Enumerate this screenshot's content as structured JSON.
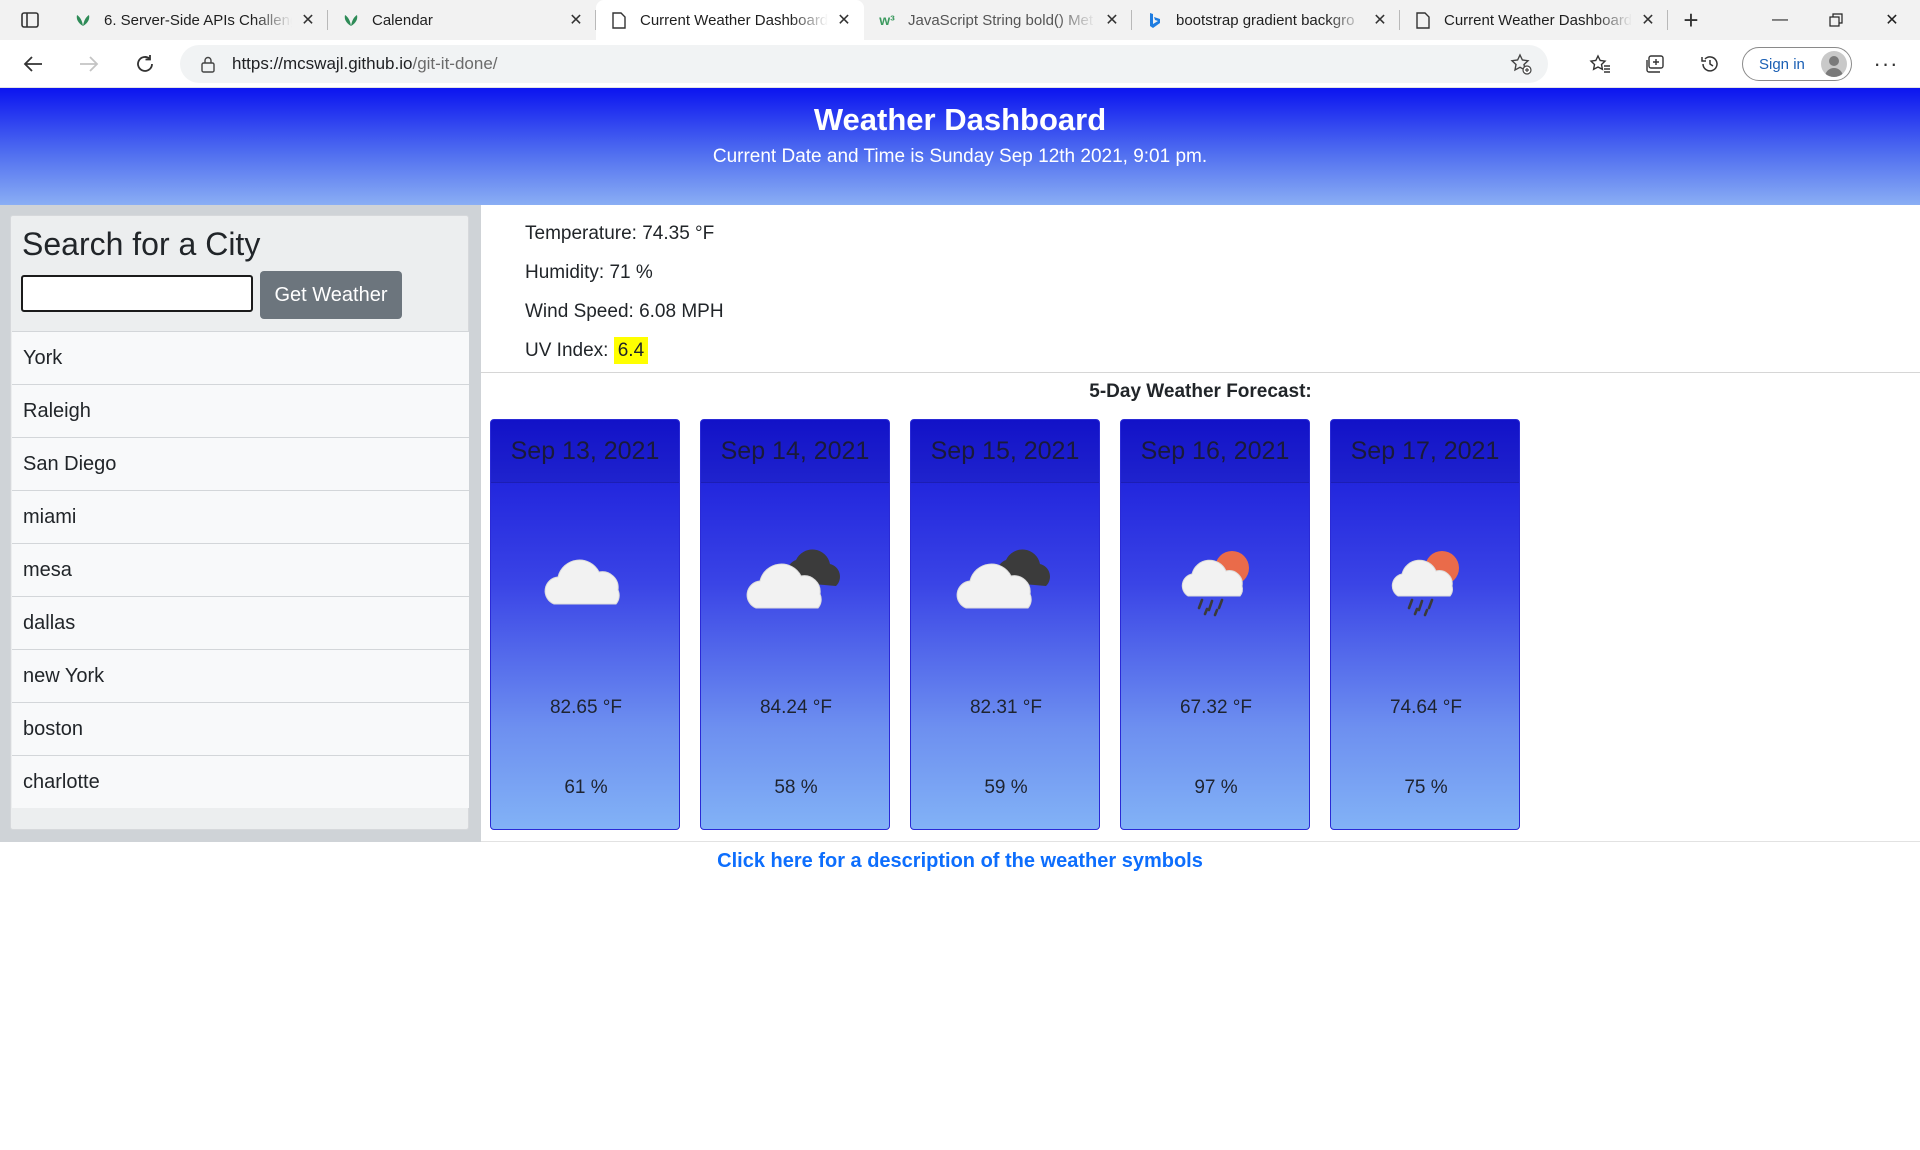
{
  "browser": {
    "tabs": [
      {
        "title": "6. Server-Side APIs Challeng",
        "icon": "leaf-icon",
        "active": false
      },
      {
        "title": "Calendar",
        "icon": "leaf-icon",
        "active": false
      },
      {
        "title": "Current Weather Dashboard",
        "icon": "page-icon",
        "active": true
      },
      {
        "title": "JavaScript String bold() Met",
        "icon": "w3-icon",
        "active": false
      },
      {
        "title": "bootstrap gradient backgro",
        "icon": "bing-icon",
        "active": false
      },
      {
        "title": "Current Weather Dashboard",
        "icon": "page-icon",
        "active": false
      }
    ],
    "url_host": "https://mcswajl.github.io",
    "url_path": "/git-it-done/",
    "signin_label": "Sign in"
  },
  "header": {
    "title": "Weather Dashboard",
    "datetime": "Current Date and Time is Sunday Sep 12th 2021, 9:01 pm."
  },
  "search": {
    "heading": "Search for a City",
    "input_value": "",
    "button_label": "Get Weather",
    "history": [
      "York",
      "Raleigh",
      "San Diego",
      "miami",
      "mesa",
      "dallas",
      "new York",
      "boston",
      "charlotte"
    ]
  },
  "current": {
    "temperature": "Temperature: 74.35 °F",
    "humidity": "Humidity: 71 %",
    "wind": "Wind Speed: 6.08 MPH",
    "uv_label": "UV Index: ",
    "uv_value": "6.4",
    "uv_color": "#ffff00"
  },
  "forecast": {
    "heading": "5-Day Weather Forecast:",
    "days": [
      {
        "date": "Sep 13, 2021",
        "icon": "cloud-icon",
        "temp": "82.65 °F",
        "humidity": "61 %"
      },
      {
        "date": "Sep 14, 2021",
        "icon": "broken-clouds-icon",
        "temp": "84.24 °F",
        "humidity": "58 %"
      },
      {
        "date": "Sep 15, 2021",
        "icon": "broken-clouds-icon",
        "temp": "82.31 °F",
        "humidity": "59 %"
      },
      {
        "date": "Sep 16, 2021",
        "icon": "rain-sun-icon",
        "temp": "67.32 °F",
        "humidity": "97 %"
      },
      {
        "date": "Sep 17, 2021",
        "icon": "rain-sun-icon",
        "temp": "74.64 °F",
        "humidity": "75 %"
      }
    ]
  },
  "footer_link": "Click here for a description of the weather symbols",
  "colors": {
    "header_gradient_top": "#0b14f0",
    "header_gradient_bottom": "#8aaef4",
    "button_gray": "#6c757d",
    "link_blue": "#0d6efd"
  }
}
